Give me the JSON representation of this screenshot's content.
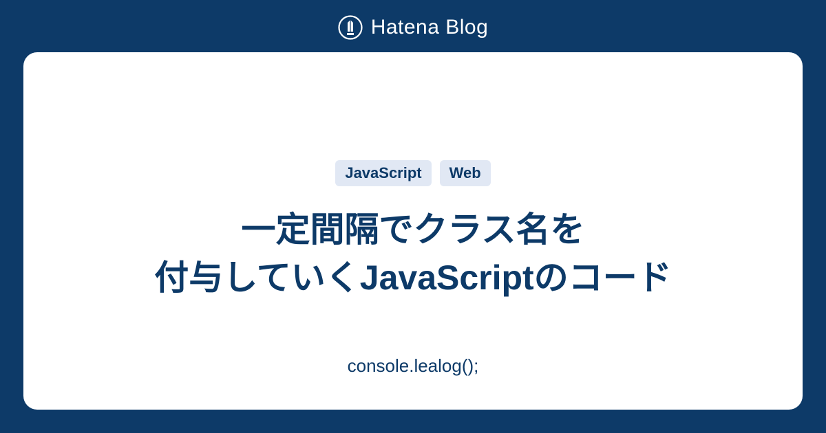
{
  "header": {
    "brand_name": "Hatena Blog"
  },
  "card": {
    "tags": [
      "JavaScript",
      "Web"
    ],
    "title_line1": "一定間隔でクラス名を",
    "title_line2": "付与していくJavaScriptのコード",
    "blog_name": "console.lealog();"
  },
  "colors": {
    "background": "#0d3a68",
    "card_bg": "#ffffff",
    "tag_bg": "#e1e8f4",
    "text_primary": "#0d3a68",
    "text_light": "#ffffff"
  }
}
